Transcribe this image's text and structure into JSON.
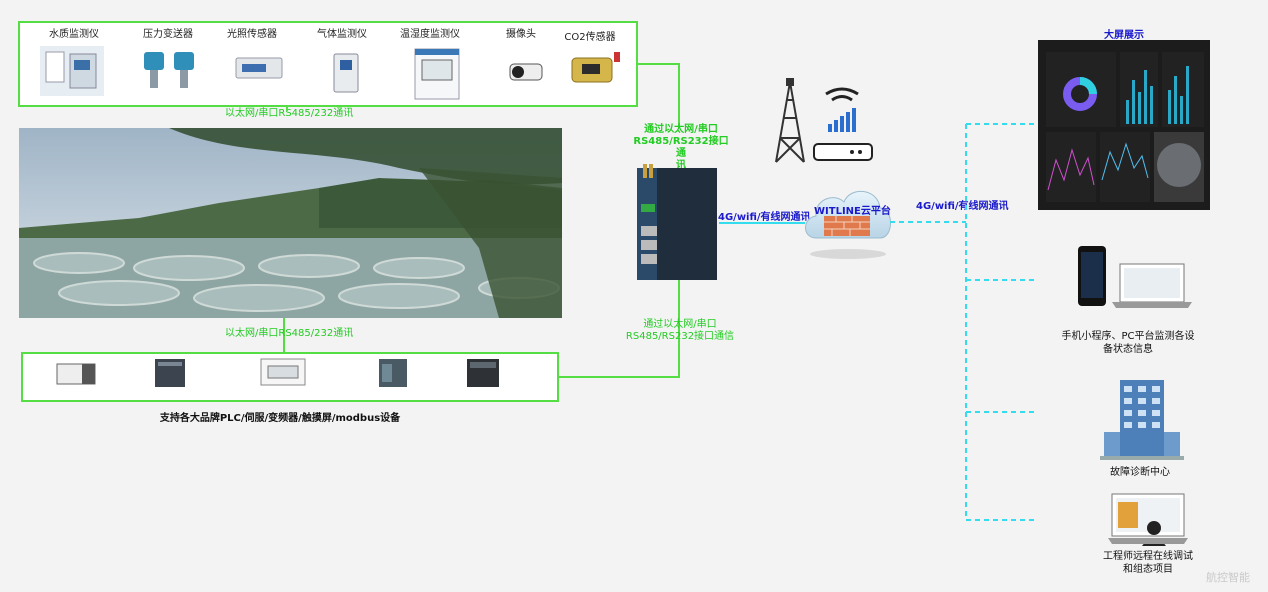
{
  "sensors_top": [
    "水质监测仪",
    "压力变送器",
    "光照传感器",
    "气体监测仪",
    "温湿度监测仪",
    "摄像头",
    "CO2传感器"
  ],
  "link_top": "以太网/串口RS485/232通讯",
  "link_bottom": "以太网/串口RS485/232通讯",
  "plc_caption": "支持各大品牌PLC/伺服/变频器/触摸屏/modbus设备",
  "gateway_top_label": "通过以太网/串口\nRS485/RS232接口通\n讯",
  "gateway_bottom_label": "通过以太网/串口\nRS485/RS232接口通信",
  "gateway_to_cloud": "4G/wifi/有线网通讯",
  "cloud_label": "WITLINE云平台",
  "cloud_to_clients": "4G/wifi/有线网通讯",
  "screen_title": "大屏展示",
  "mobile_pc_label": "手机小程序、PC平台监测各设\n备状态信息",
  "fault_center_label": "故障诊断中心",
  "engineer_label": "工程师远程在线调试\n和组态项目",
  "watermark": "航控智能",
  "colors": {
    "green_line": "#55dd44",
    "cyan_dash": "#33ddee",
    "blue_text": "#1a1acc"
  }
}
